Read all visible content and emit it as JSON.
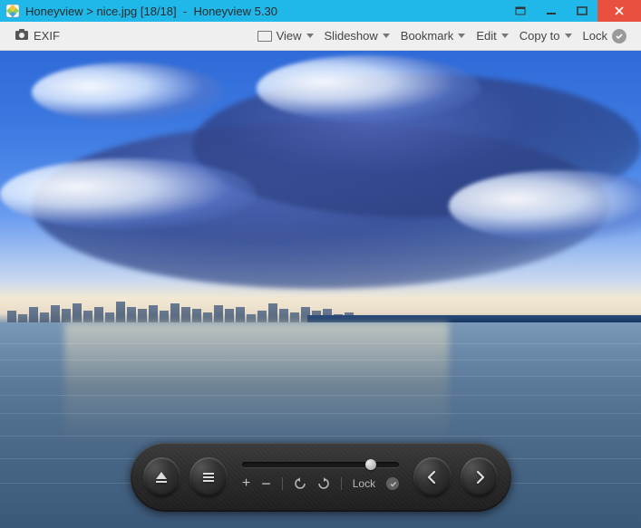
{
  "titlebar": {
    "app_name": "Honeyview",
    "separator": ">",
    "filename": "nice.jpg",
    "counter": "[18/18]",
    "dash": "-",
    "app_title": "Honeyview 5.30"
  },
  "toolbar": {
    "exif_label": "EXIF",
    "view_label": "View",
    "slideshow_label": "Slideshow",
    "bookmark_label": "Bookmark",
    "edit_label": "Edit",
    "copyto_label": "Copy to",
    "lock_label": "Lock"
  },
  "controls": {
    "slider_position_pct": 82,
    "lock_label": "Lock",
    "icons": {
      "eject": "eject-icon",
      "menu": "menu-icon",
      "prev": "chevron-left-icon",
      "next": "chevron-right-icon",
      "zoom_in": "+",
      "zoom_out": "−",
      "rotate_ccw": "rotate-left-icon",
      "rotate_cw": "rotate-right-icon"
    }
  }
}
